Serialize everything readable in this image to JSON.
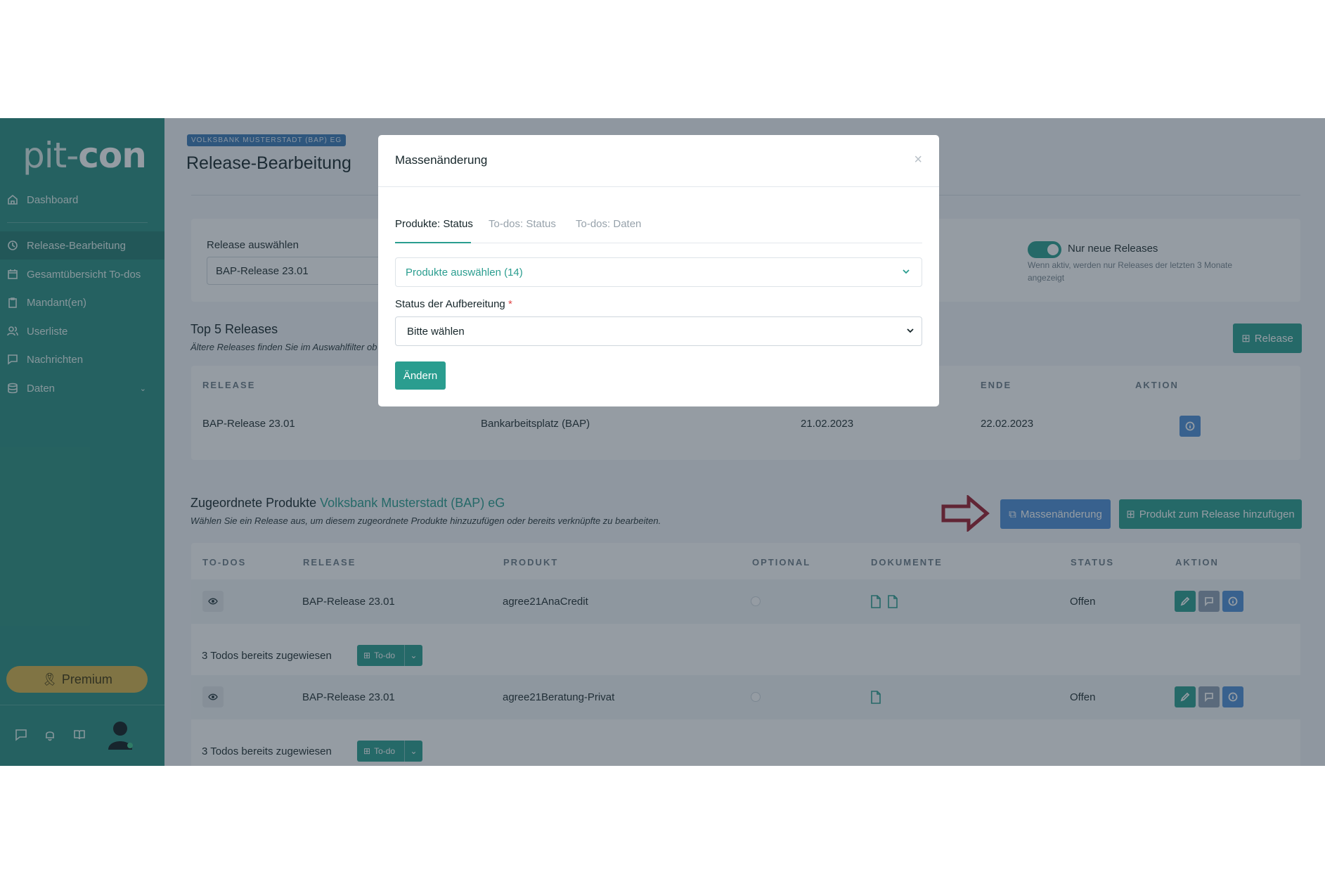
{
  "sidebar": {
    "logo_left": "pit-",
    "logo_right": "con",
    "items": [
      {
        "label": "Dashboard"
      },
      {
        "label": "Release-Bearbeitung"
      },
      {
        "label": "Gesamtübersicht To-dos"
      },
      {
        "label": "Mandant(en)"
      },
      {
        "label": "Userliste"
      },
      {
        "label": "Nachrichten"
      },
      {
        "label": "Daten"
      }
    ],
    "premium_label": "Premium"
  },
  "header": {
    "org_badge": "VOLKSBANK MUSTERSTADT (BAP) EG",
    "title": "Release-Bearbeitung"
  },
  "release_filter": {
    "label": "Release auswählen",
    "value": "BAP-Release 23.01",
    "toggle_label": "Nur neue Releases",
    "toggle_hint": "Wenn aktiv, werden nur Releases der letzten 3 Monate angezeigt"
  },
  "top_releases": {
    "title": "Top 5 Releases",
    "subtitle": "Ältere Releases finden Sie im Auswahlfilter ob",
    "add_button": "Release",
    "columns": [
      "RELEASE",
      "ENDE",
      "AKTION"
    ],
    "rows": [
      {
        "release": "BAP-Release 23.01",
        "product": "Bankarbeitsplatz (BAP)",
        "start": "21.02.2023",
        "end": "22.02.2023"
      }
    ]
  },
  "products": {
    "title_prefix": "Zugeordnete Produkte",
    "title_org": "Volksbank Musterstadt (BAP) eG",
    "subtitle": "Wählen Sie ein Release aus, um diesem zugeordnete Produkte hinzuzufügen oder bereits verknüpfte zu bearbeiten.",
    "mass_button": "Massenänderung",
    "add_button": "Produkt zum Release hinzufügen",
    "columns": [
      "TO-DOS",
      "RELEASE",
      "PRODUKT",
      "OPTIONAL",
      "DOKUMENTE",
      "STATUS",
      "AKTION"
    ],
    "rows": [
      {
        "release": "BAP-Release 23.01",
        "product": "agree21AnaCredit",
        "status": "Offen",
        "todos_text": "3 Todos bereits zugewiesen",
        "todo_button": "To-do"
      },
      {
        "release": "BAP-Release 23.01",
        "product": "agree21Beratung-Privat",
        "status": "Offen",
        "todos_text": "3 Todos bereits zugewiesen",
        "todo_button": "To-do"
      }
    ]
  },
  "modal": {
    "title": "Massenänderung",
    "close": "×",
    "tabs": [
      "Produkte: Status",
      "To-dos: Status",
      "To-dos: Daten"
    ],
    "product_select": "Produkte auswählen (14)",
    "status_label": "Status der Aufbereitung",
    "required_mark": "*",
    "status_value": "Bitte wählen",
    "apply_button": "Ändern"
  },
  "colors": {
    "brand": "#2a8f80",
    "accent": "#2a9d8f",
    "blue": "#4d8fd6",
    "premium": "#d6b34a",
    "arrow": "#9b1c2c"
  }
}
